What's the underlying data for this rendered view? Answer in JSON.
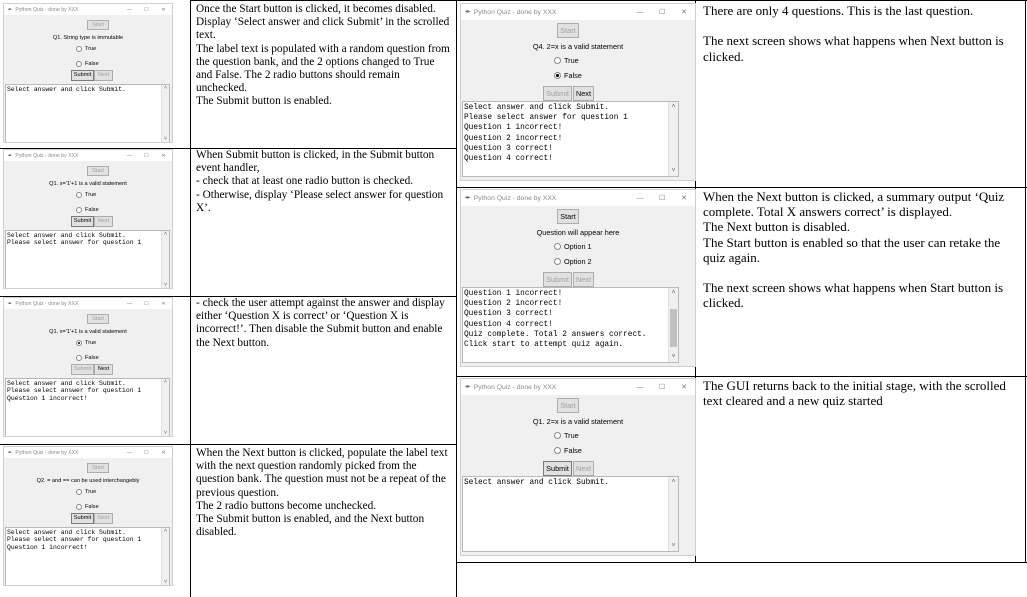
{
  "window_title": "Python Quiz - done by XXX",
  "window_controls": {
    "minimize": "—",
    "maximize": "☐",
    "close": "✕"
  },
  "labels": {
    "start": "Start",
    "submit": "Submit",
    "next": "Next"
  },
  "screens": [
    {
      "question": "Q1. String type is immutable",
      "options": [
        "True",
        "False"
      ],
      "output": [
        "Select answer and click Submit."
      ]
    },
    {
      "question": "Q1. x='1'+1 is a valid statement",
      "options": [
        "True",
        "False"
      ],
      "output": [
        "Select answer and click Submit.",
        "Please select answer for question 1"
      ]
    },
    {
      "question": "Q1. x='1'+1 is a valid statement",
      "options": [
        "True",
        "False"
      ],
      "output": [
        "Select answer and click Submit.",
        "Please select answer for question 1",
        "Question 1 incorrect!"
      ]
    },
    {
      "question": "Q2. = and == can be used interchangebly",
      "options": [
        "True",
        "False"
      ],
      "output": [
        "Select answer and click Submit.",
        "Please select answer for question 1",
        "Question 1 incorrect!"
      ]
    },
    {
      "question": "Q4. 2=x is a valid statement",
      "options": [
        "True",
        "False"
      ],
      "output": [
        "Select answer and click Submit.",
        "Please select answer for question 1",
        "Question 1 incorrect!",
        "Question 2 incorrect!",
        "Question 3 correct!",
        "Question 4 correct!"
      ]
    },
    {
      "question": "Question will appear here",
      "options": [
        "Option 1",
        "Option 2"
      ],
      "output": [
        "Question 1 incorrect!",
        "Question 2 incorrect!",
        "Question 3 correct!",
        "Question 4 correct!",
        "Quiz complete. Total 2 answers correct.",
        "Click start to attempt quiz again."
      ]
    },
    {
      "question": "Q1. 2=x is a valid statement",
      "options": [
        "True",
        "False"
      ],
      "output": [
        "Select answer and click Submit."
      ]
    }
  ],
  "descriptions": [
    [
      "Once the Start button is clicked, it becomes disabled. Display ‘Select answer and click Submit’ in the scrolled text.",
      "The label text is populated with a random question from the question bank, and the 2 options changed to True and False. The 2 radio buttons should remain unchecked.",
      "The Submit button is enabled."
    ],
    [
      "When Submit button is clicked, in the Submit button event handler,",
      "- check that at least one radio button is checked.",
      "- Otherwise, display ‘Please select answer for question X’."
    ],
    [
      "- check the user attempt against the answer and display either ‘Question X is correct’ or ‘Question X is incorrect!’. Then disable the Submit button and enable the Next button."
    ],
    [
      "When the Next button is clicked, populate the label text with the next question randomly picked from the question bank. The question must not be a repeat of the previous question.",
      "The 2 radio buttons become unchecked.",
      "The Submit button is enabled, and the Next button disabled."
    ],
    [
      "There are only 4 questions. This is the last question.",
      "",
      "The next screen shows what happens when Next button is clicked."
    ],
    [
      "When the Next button is clicked, a summary output ‘Quiz complete. Total X answers correct’ is displayed.",
      "The Next button is disabled.",
      "The Start button is enabled so that the user can retake the quiz again.",
      "",
      "The next screen shows what happens when Start button is clicked."
    ],
    [
      "The GUI returns back to the initial stage, with the scrolled text cleared and a new quiz started"
    ]
  ]
}
